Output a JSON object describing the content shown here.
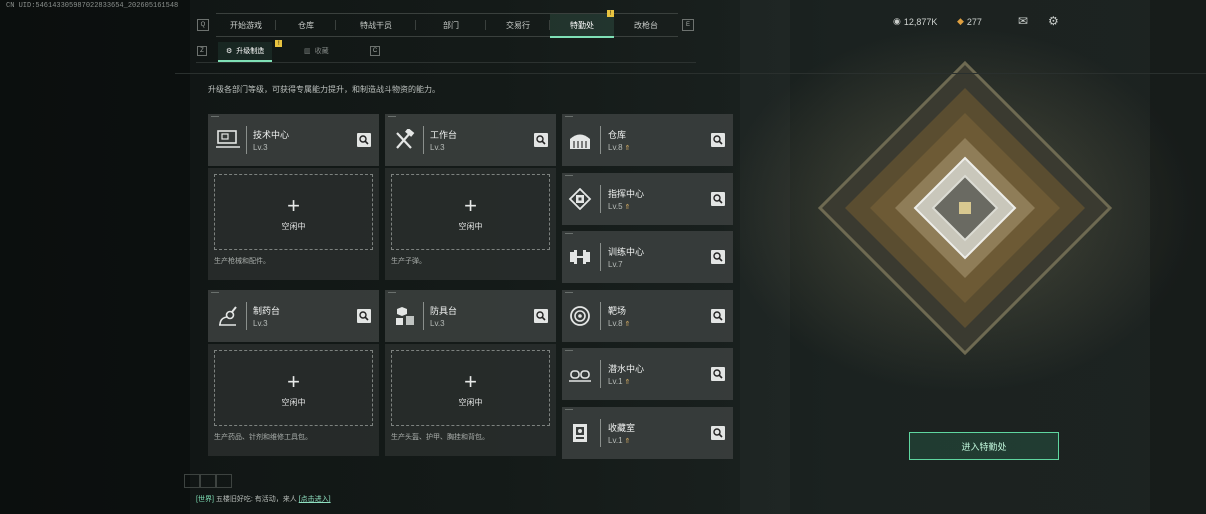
{
  "uid_text": "CN UID:546143305987022833654_202605161548",
  "top_tabs": [
    {
      "label": "开始游戏",
      "active": false
    },
    {
      "label": "仓库",
      "active": false
    },
    {
      "label": "特战干员",
      "active": false
    },
    {
      "label": "部门",
      "active": false
    },
    {
      "label": "交易行",
      "active": false
    },
    {
      "label": "特勤处",
      "active": true,
      "badge": "!"
    },
    {
      "label": "改枪台",
      "active": false
    }
  ],
  "hotkeys": {
    "left": "Q",
    "right": "E",
    "sub_left": "Z",
    "sub_right": "C"
  },
  "sub_tabs": [
    {
      "label": "升级制造",
      "active": true,
      "badge": "!"
    },
    {
      "label": "收藏",
      "active": false
    }
  ],
  "currency": {
    "coins": "12,877K",
    "tickets": "277"
  },
  "description": "升级各部门等级，可获得专属能力提升，和制造战斗物资的能力。",
  "stations": [
    {
      "name": "技术中心",
      "level": "Lv.3",
      "icon": "computer-icon",
      "status": "空闲中",
      "produces": "生产枪械和配件。"
    },
    {
      "name": "工作台",
      "level": "Lv.3",
      "icon": "tools-icon",
      "status": "空闲中",
      "produces": "生产子弹。"
    },
    {
      "name": "制药台",
      "level": "Lv.3",
      "icon": "microscope-icon",
      "status": "空闲中",
      "produces": "生产药品、针剂和维修工具包。"
    },
    {
      "name": "防具台",
      "level": "Lv.3",
      "icon": "armor-icon",
      "status": "空闲中",
      "produces": "生产头盔、护甲、胸挂和背包。"
    }
  ],
  "departments": [
    {
      "name": "仓库",
      "level": "Lv.8",
      "icon": "warehouse-icon",
      "upgradable": true
    },
    {
      "name": "指挥中心",
      "level": "Lv.5",
      "icon": "command-center-icon",
      "upgradable": true
    },
    {
      "name": "训练中心",
      "level": "Lv.7",
      "icon": "dumbbell-icon",
      "upgradable": false
    },
    {
      "name": "靶场",
      "level": "Lv.8",
      "icon": "target-icon",
      "upgradable": true
    },
    {
      "name": "潜水中心",
      "level": "Lv.1",
      "icon": "diving-goggles-icon",
      "upgradable": true
    },
    {
      "name": "收藏室",
      "level": "Lv.1",
      "icon": "collection-icon",
      "upgradable": true
    }
  ],
  "enter_button": "进入特勤处",
  "chat": {
    "channel": "[世界]",
    "message": "五楼旧好吃: 有活动，来人",
    "link": "[点击进入]"
  },
  "colors": {
    "accent": "#7fe0b6",
    "card": "#3a3e3d",
    "upgrade": "#d9b066"
  }
}
